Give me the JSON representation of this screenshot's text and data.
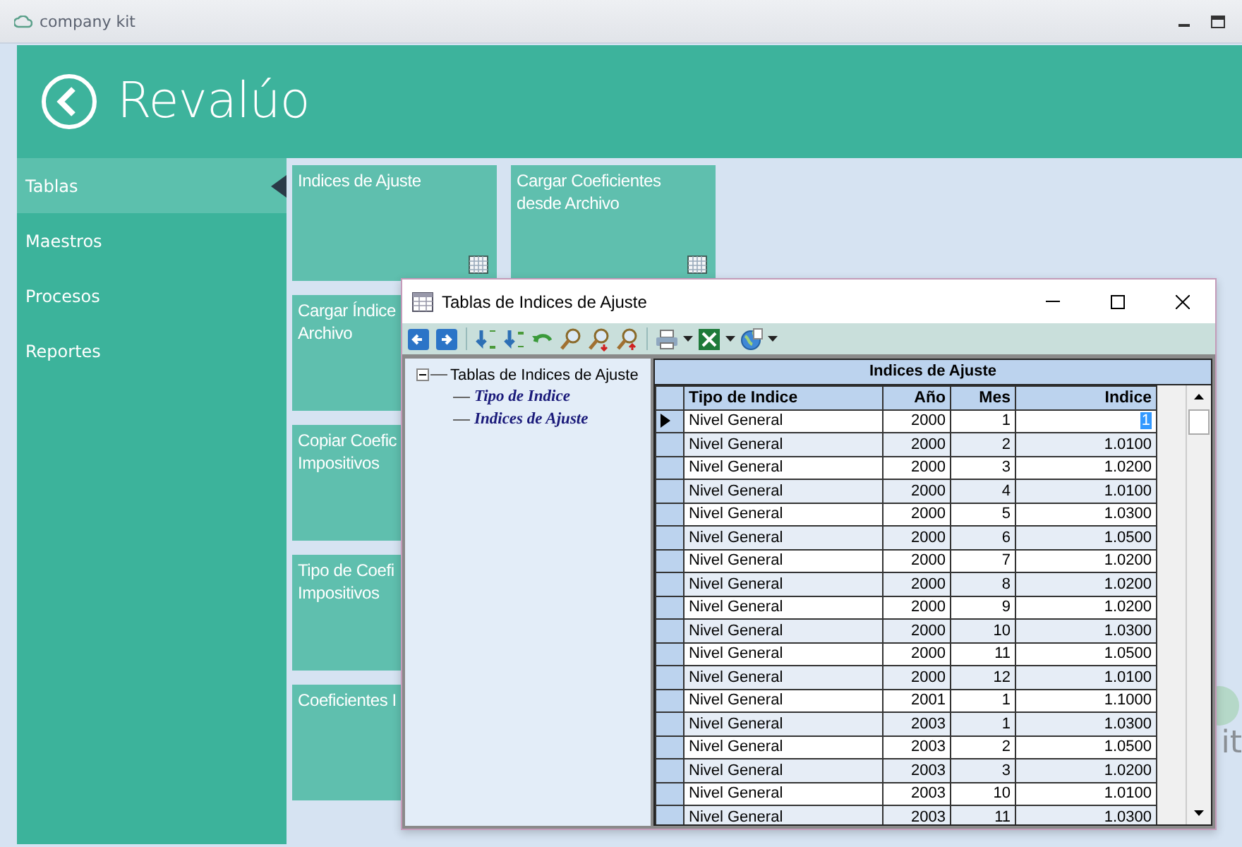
{
  "app": {
    "title": "company kit"
  },
  "header": {
    "title": "Revalúo"
  },
  "sidebar": {
    "items": [
      {
        "label": "Tablas",
        "selected": true
      },
      {
        "label": "Maestros",
        "selected": false
      },
      {
        "label": "Procesos",
        "selected": false
      },
      {
        "label": "Reportes",
        "selected": false
      }
    ]
  },
  "tile_columns": [
    [
      {
        "lines": [
          "Indices de Ajuste"
        ],
        "has_icon": true
      },
      {
        "lines": [
          "Cargar Índice",
          "Archivo"
        ],
        "has_icon": false
      },
      {
        "lines": [
          "Copiar Coefic",
          "Impositivos"
        ],
        "has_icon": false
      },
      {
        "lines": [
          "Tipo de Coefi",
          "Impositivos"
        ],
        "has_icon": false
      },
      {
        "lines": [
          "Coeficientes I"
        ],
        "has_icon": false
      }
    ],
    [
      {
        "lines": [
          "Cargar Coeficientes",
          "desde Archivo"
        ],
        "has_icon": true
      }
    ]
  ],
  "background_logo": {
    "text": "it"
  },
  "dialog": {
    "title": "Tablas de Indices de Ajuste",
    "tree": {
      "label": "Tablas de Indices de Ajuste",
      "expanded": true,
      "children": [
        {
          "label": "Tipo de Indice"
        },
        {
          "label": "Indices de Ajuste"
        }
      ]
    },
    "grid": {
      "caption": "Indices de Ajuste",
      "columns": [
        "Tipo de Indice",
        "Año",
        "Mes",
        "Indice"
      ],
      "rows": [
        {
          "selected": true,
          "cells": [
            "Nivel General",
            "2000",
            "1",
            "1"
          ]
        },
        {
          "selected": false,
          "cells": [
            "Nivel General",
            "2000",
            "2",
            "1.0100"
          ]
        },
        {
          "selected": false,
          "cells": [
            "Nivel General",
            "2000",
            "3",
            "1.0200"
          ]
        },
        {
          "selected": false,
          "cells": [
            "Nivel General",
            "2000",
            "4",
            "1.0100"
          ]
        },
        {
          "selected": false,
          "cells": [
            "Nivel General",
            "2000",
            "5",
            "1.0300"
          ]
        },
        {
          "selected": false,
          "cells": [
            "Nivel General",
            "2000",
            "6",
            "1.0500"
          ]
        },
        {
          "selected": false,
          "cells": [
            "Nivel General",
            "2000",
            "7",
            "1.0200"
          ]
        },
        {
          "selected": false,
          "cells": [
            "Nivel General",
            "2000",
            "8",
            "1.0200"
          ]
        },
        {
          "selected": false,
          "cells": [
            "Nivel General",
            "2000",
            "9",
            "1.0200"
          ]
        },
        {
          "selected": false,
          "cells": [
            "Nivel General",
            "2000",
            "10",
            "1.0300"
          ]
        },
        {
          "selected": false,
          "cells": [
            "Nivel General",
            "2000",
            "11",
            "1.0500"
          ]
        },
        {
          "selected": false,
          "cells": [
            "Nivel General",
            "2000",
            "12",
            "1.0100"
          ]
        },
        {
          "selected": false,
          "cells": [
            "Nivel General",
            "2001",
            "1",
            "1.1000"
          ]
        },
        {
          "selected": false,
          "cells": [
            "Nivel General",
            "2003",
            "1",
            "1.0300"
          ]
        },
        {
          "selected": false,
          "cells": [
            "Nivel General",
            "2003",
            "2",
            "1.0500"
          ]
        },
        {
          "selected": false,
          "cells": [
            "Nivel General",
            "2003",
            "3",
            "1.0200"
          ]
        },
        {
          "selected": false,
          "cells": [
            "Nivel General",
            "2003",
            "10",
            "1.0100"
          ]
        },
        {
          "selected": false,
          "cells": [
            "Nivel General",
            "2003",
            "11",
            "1.0300"
          ]
        }
      ]
    }
  }
}
